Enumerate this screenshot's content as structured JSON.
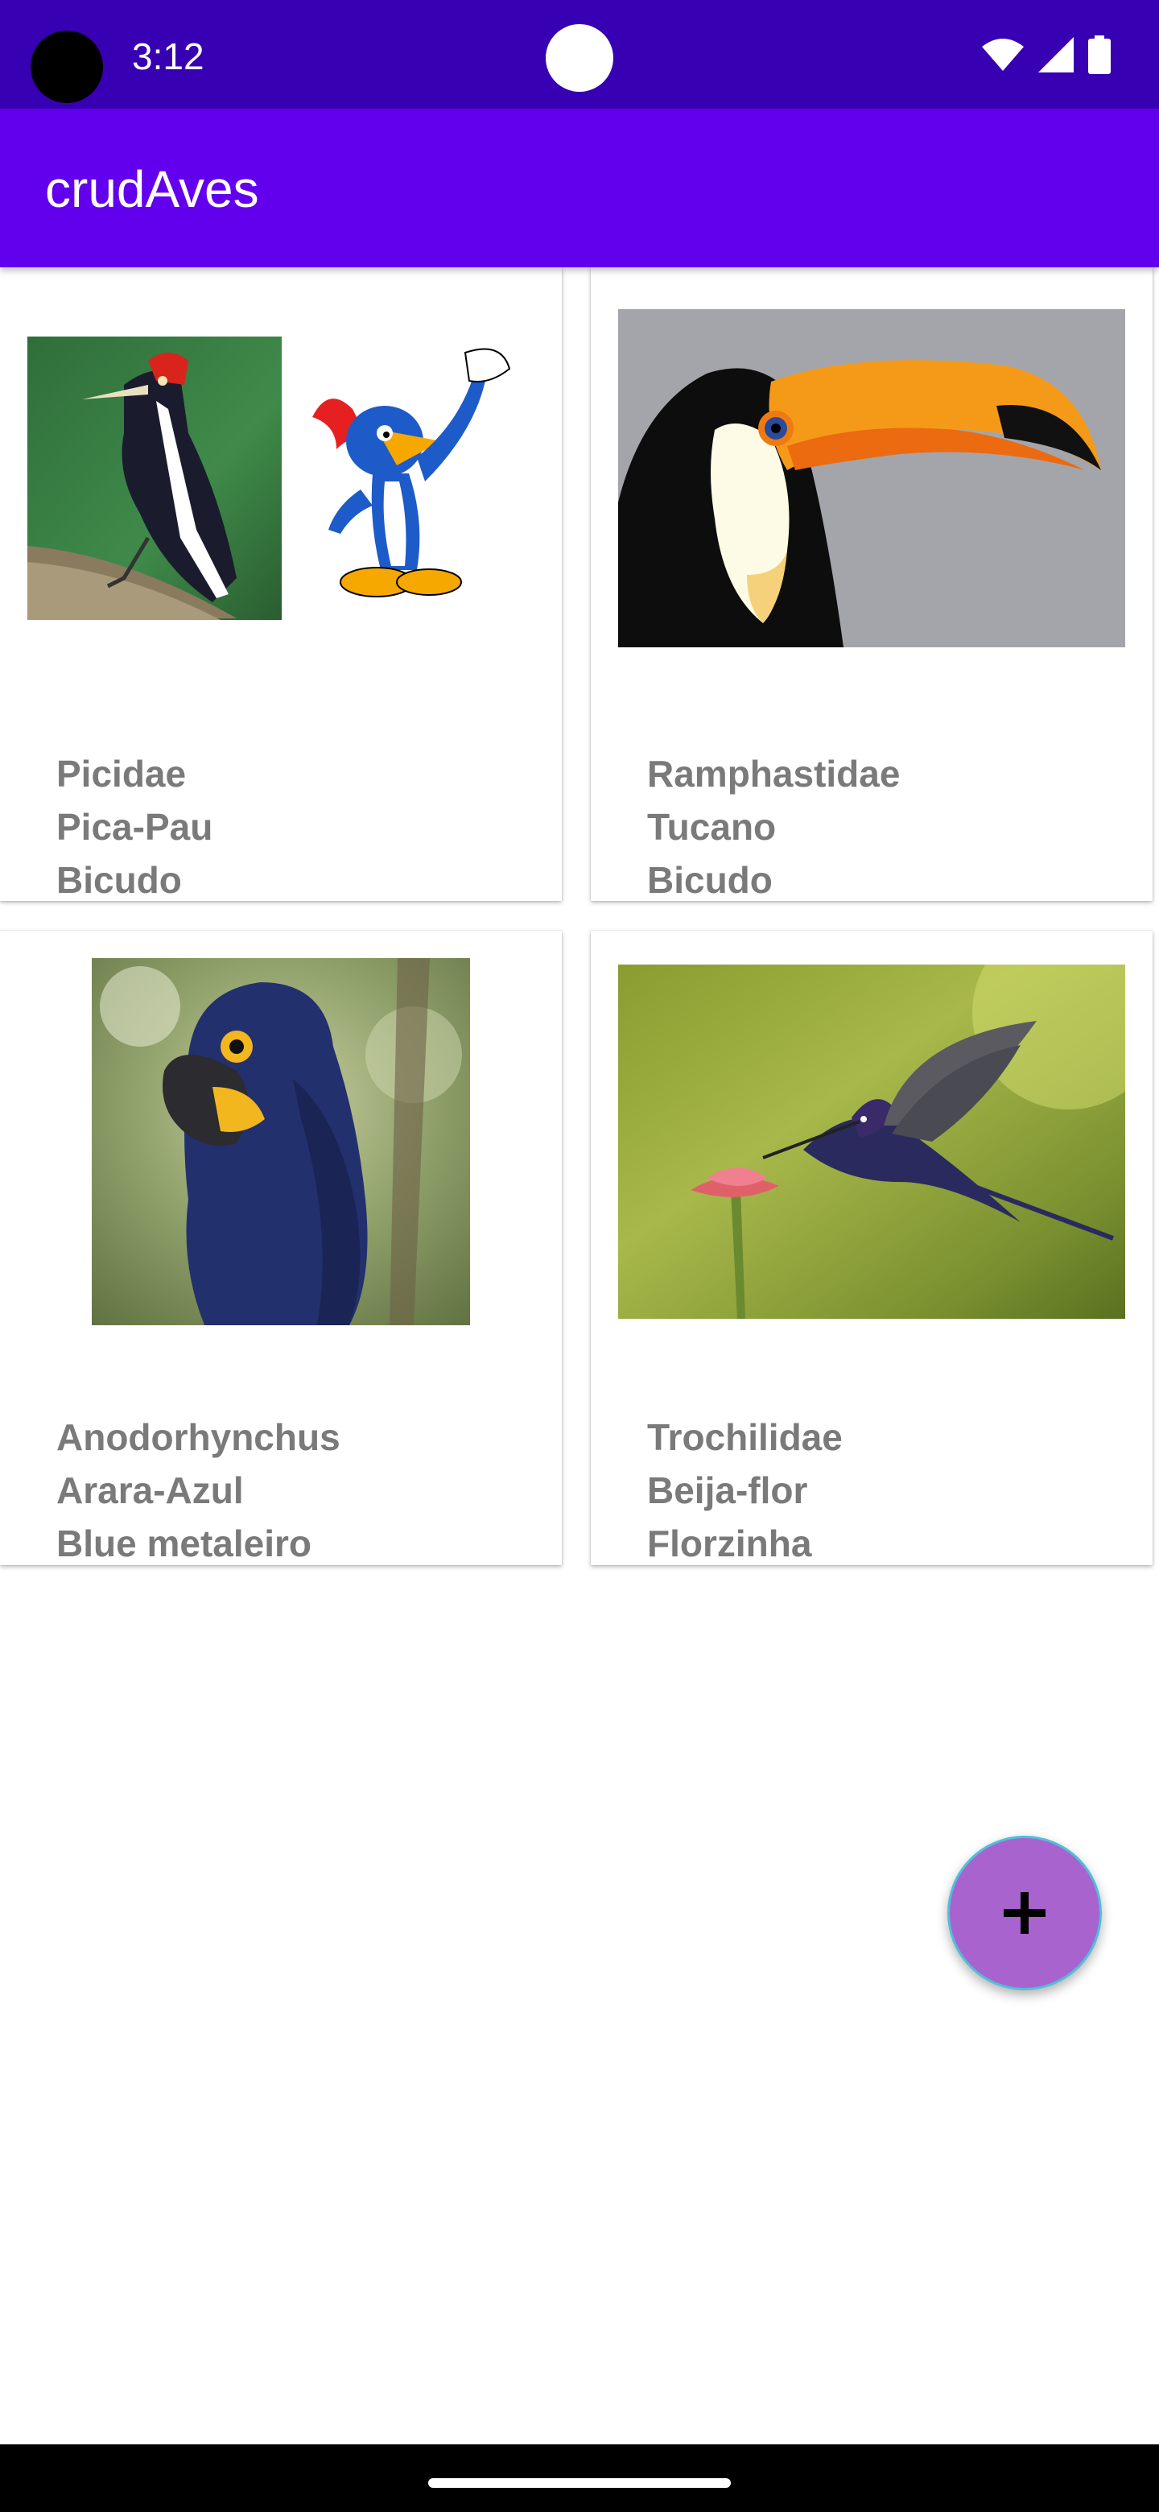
{
  "status_bar": {
    "time": "3:12",
    "icons": [
      "wifi-icon",
      "signal-icon",
      "battery-icon"
    ],
    "color": "#3700b3"
  },
  "app_bar": {
    "title": "crudAves",
    "color": "#6200ee"
  },
  "cards": [
    {
      "family": "Picidae",
      "name": "Pica-Pau",
      "nickname": "Bicudo",
      "image": "woodpecker-and-woody-woodpecker-image"
    },
    {
      "family": "Ramphastidae",
      "name": "Tucano",
      "nickname": "Bicudo",
      "image": "toucan-image"
    },
    {
      "family": "Anodorhynchus",
      "name": "Arara-Azul",
      "nickname": "Blue metaleiro",
      "image": "hyacinth-macaw-image"
    },
    {
      "family": "Trochilidae",
      "name": "Beija-flor",
      "nickname": "Florzinha",
      "image": "hummingbird-image"
    }
  ],
  "fab": {
    "icon": "plus-icon",
    "color": "#a963cf"
  }
}
